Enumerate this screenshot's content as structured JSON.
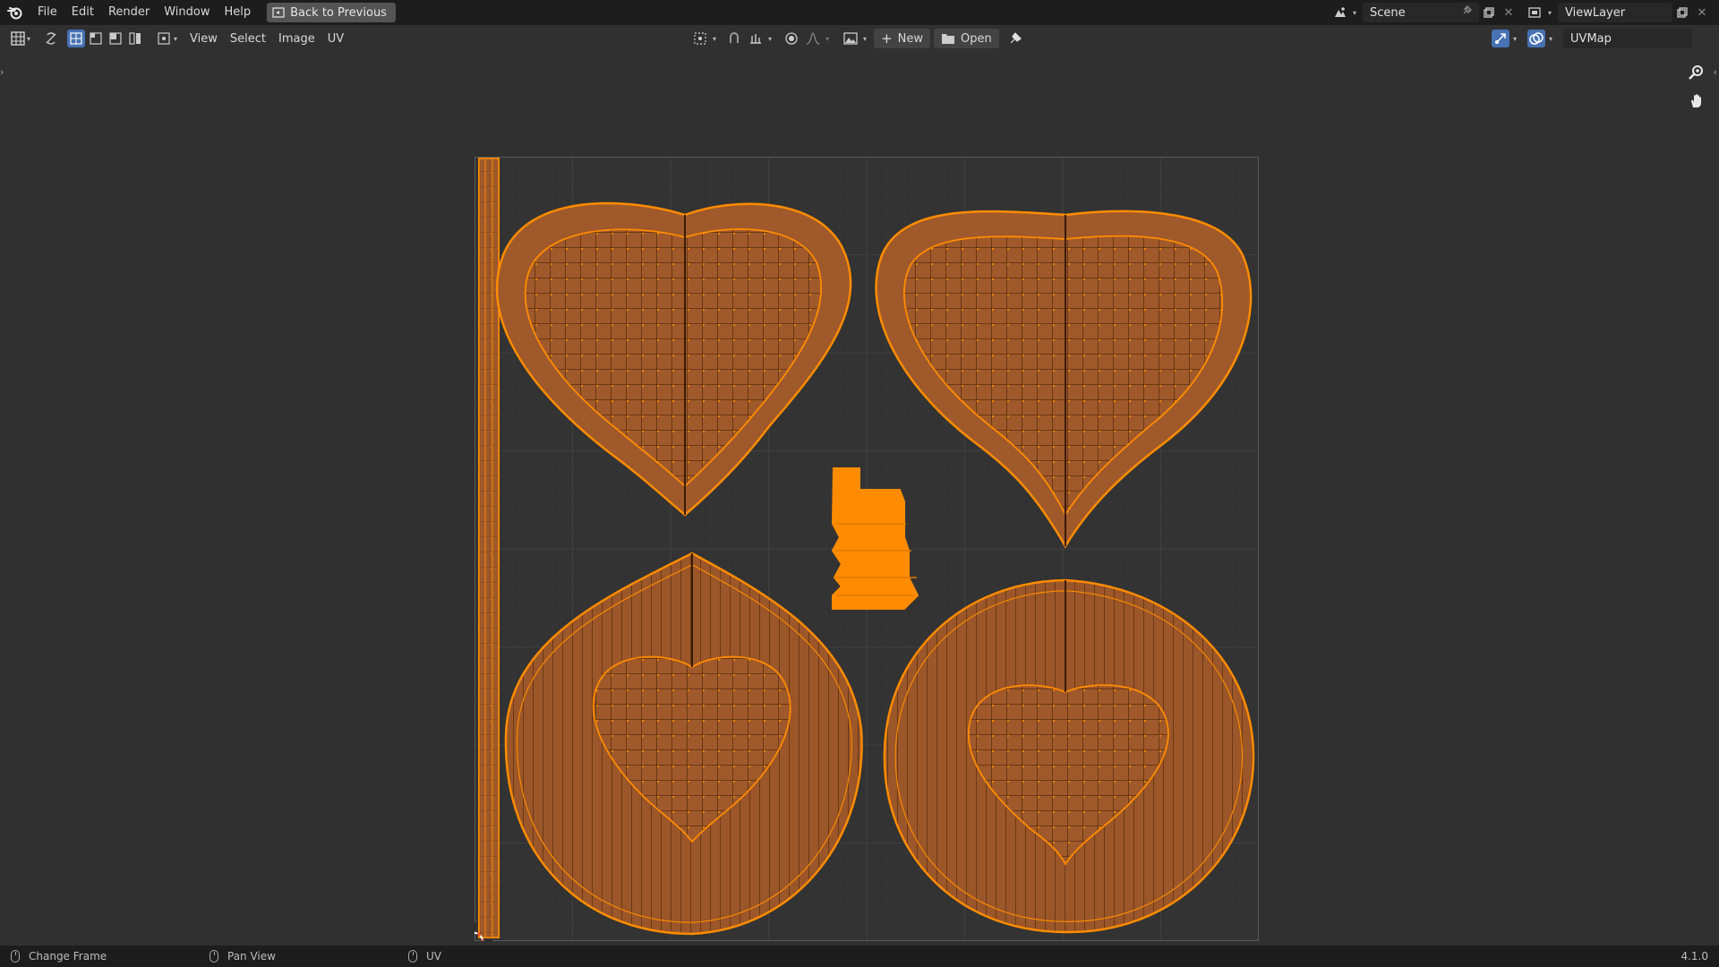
{
  "menu": {
    "items": [
      "File",
      "Edit",
      "Render",
      "Window",
      "Help"
    ],
    "back_button": "Back to Previous"
  },
  "scene": {
    "name": "Scene"
  },
  "view_layer": {
    "name": "ViewLayer"
  },
  "header": {
    "menus": [
      "View",
      "Select",
      "Image",
      "UV"
    ],
    "new_label": "New",
    "open_label": "Open",
    "uv_map": "UVMap"
  },
  "status": {
    "left_action": "Change Frame",
    "middle_action": "Pan View",
    "right_action": "UV",
    "version": "4.1.0"
  },
  "colors": {
    "accent": "#4772b3",
    "uv_face": "#a05a2c",
    "uv_edge": "#ff8c00",
    "background": "#303030"
  },
  "icons": [
    "blender-logo",
    "editor-type-icon",
    "sync-selection-icon",
    "vertex-select-icon",
    "edge-select-icon",
    "face-select-icon",
    "island-select-icon",
    "pivot-icon",
    "snap-icon",
    "proportional-icon",
    "image-browse-icon",
    "pin-icon",
    "gizmo-icon",
    "overlay-icon",
    "zoom-icon",
    "hand-icon"
  ]
}
